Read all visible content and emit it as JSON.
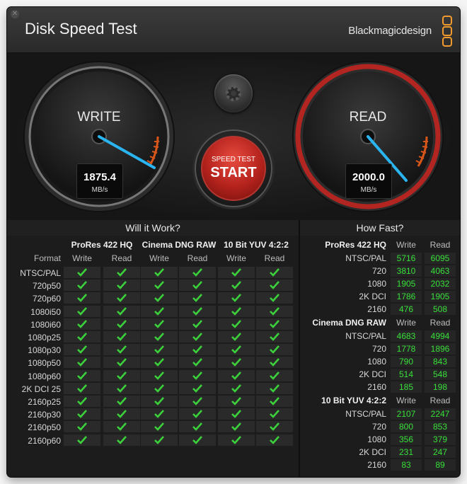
{
  "app_title": "Disk Speed Test",
  "brand_name": "Blackmagicdesign",
  "colors": {
    "accent_orange": "#f29a2e",
    "needle": "#2ab4f0",
    "check_green": "#3bd13b",
    "value_green": "#38e03a",
    "read_ring": "#b32520"
  },
  "write_gauge": {
    "label": "WRITE",
    "value": "1875.4",
    "unit": "MB/s"
  },
  "read_gauge": {
    "label": "READ",
    "value": "2000.0",
    "unit": "MB/s"
  },
  "settings_icon": "gear-icon",
  "start_button": {
    "small_label": "SPEED TEST",
    "big_label": "START"
  },
  "will_it_work": {
    "title": "Will it Work?",
    "format_header": "Format",
    "groups": [
      "ProRes 422 HQ",
      "Cinema DNG RAW",
      "10 Bit YUV 4:2:2"
    ],
    "columns": [
      "Write",
      "Read",
      "Write",
      "Read",
      "Write",
      "Read"
    ],
    "rows": [
      "NTSC/PAL",
      "720p50",
      "720p60",
      "1080i50",
      "1080i60",
      "1080p25",
      "1080p30",
      "1080p50",
      "1080p60",
      "2K DCI 25",
      "2160p25",
      "2160p30",
      "2160p50",
      "2160p60"
    ],
    "status_icon": "check-icon"
  },
  "how_fast": {
    "title": "How Fast?",
    "sections": [
      {
        "name": "ProRes 422 HQ",
        "write_label": "Write",
        "read_label": "Read",
        "rows": [
          {
            "format": "NTSC/PAL",
            "write": "5716",
            "read": "6095"
          },
          {
            "format": "720",
            "write": "3810",
            "read": "4063"
          },
          {
            "format": "1080",
            "write": "1905",
            "read": "2032"
          },
          {
            "format": "2K DCI",
            "write": "1786",
            "read": "1905"
          },
          {
            "format": "2160",
            "write": "476",
            "read": "508"
          }
        ]
      },
      {
        "name": "Cinema DNG RAW",
        "write_label": "Write",
        "read_label": "Read",
        "rows": [
          {
            "format": "NTSC/PAL",
            "write": "4683",
            "read": "4994"
          },
          {
            "format": "720",
            "write": "1778",
            "read": "1896"
          },
          {
            "format": "1080",
            "write": "790",
            "read": "843"
          },
          {
            "format": "2K DCI",
            "write": "514",
            "read": "548"
          },
          {
            "format": "2160",
            "write": "185",
            "read": "198"
          }
        ]
      },
      {
        "name": "10 Bit YUV 4:2:2",
        "write_label": "Write",
        "read_label": "Read",
        "rows": [
          {
            "format": "NTSC/PAL",
            "write": "2107",
            "read": "2247"
          },
          {
            "format": "720",
            "write": "800",
            "read": "853"
          },
          {
            "format": "1080",
            "write": "356",
            "read": "379"
          },
          {
            "format": "2K DCI",
            "write": "231",
            "read": "247"
          },
          {
            "format": "2160",
            "write": "83",
            "read": "89"
          }
        ]
      }
    ]
  }
}
